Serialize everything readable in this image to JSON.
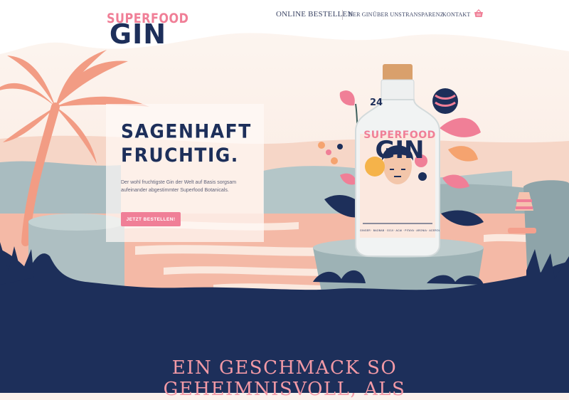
{
  "brand": {
    "logo_top": "SUPERFOOD",
    "logo_main": "GIN"
  },
  "nav": {
    "primary": "ONLINE BESTELLEN",
    "items": [
      "DER GIN",
      "ÜBER UNS",
      "TRANSPARENZ",
      "KONTAKT"
    ],
    "cart_icon": "basket-icon"
  },
  "hero": {
    "title_line1": "SAGENHAFT",
    "title_line2": "FRUCHTIG.",
    "description": "Der wohl fruchtigste Gin der Welt auf Basis sorgsam aufeinander abgestimmter Superfood Botanicals.",
    "cta_label": "JETZT BESTELLEN!"
  },
  "bottle": {
    "brand_top": "SUPERFOOD",
    "brand_main": "GIN",
    "badge_number": "24",
    "botanicals": "GINGER · BAOBAB · GOJI · ACAI · PITAYA · ARONIA · ACEROLA"
  },
  "section": {
    "headline_line1": "EIN GESCHMACK SO",
    "headline_line2": "GEHEIMNISVOLL, ALS"
  },
  "colors": {
    "navy": "#1d2f5a",
    "pink": "#f07f97",
    "headline_pink": "#f39aa6",
    "cream": "#fbf1ec"
  }
}
